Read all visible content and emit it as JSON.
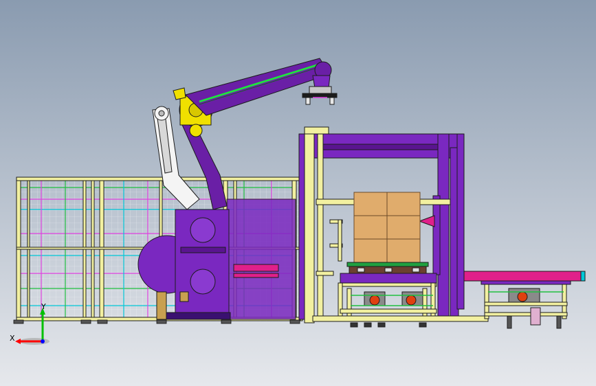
{
  "viewport": {
    "background_top": "#8a9bb0",
    "background_bottom": "#e6e8ec"
  },
  "axis_triad": {
    "x_label": "X",
    "y_label": "Y",
    "x_color": "#ff0000",
    "y_color": "#00c000",
    "z_color": "#0000ff"
  },
  "colors": {
    "robot_white": "#f4f4f4",
    "robot_yellow": "#f0e000",
    "robot_purple": "#6a1fa6",
    "frame_purple": "#7a28c0",
    "frame_yellow": "#f2f0a0",
    "conveyor_pink": "#e0208a",
    "fence_green": "#20c040",
    "fence_cyan": "#00c8d8",
    "fence_magenta": "#e040e0",
    "box_tan": "#e0ac6c",
    "pallet_brown": "#6b4030",
    "outline": "#1c1c1c"
  }
}
